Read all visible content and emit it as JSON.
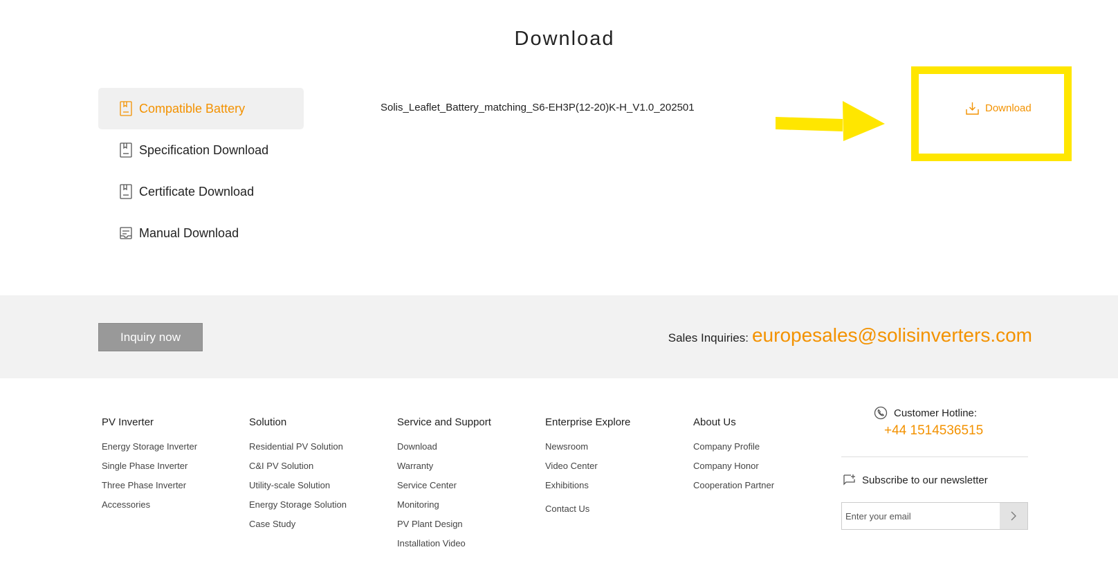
{
  "page": {
    "title": "Download"
  },
  "sidebar": {
    "items": [
      {
        "label": "Compatible Battery",
        "icon": "document-icon",
        "active": true
      },
      {
        "label": "Specification Download",
        "icon": "document-icon",
        "active": false
      },
      {
        "label": "Certificate Download",
        "icon": "document-icon",
        "active": false
      },
      {
        "label": "Manual Download",
        "icon": "manual-icon",
        "active": false
      }
    ]
  },
  "files": [
    {
      "name": "Solis_Leaflet_Battery_matching_S6-EH3P(12-20)K-H_V1.0_202501",
      "action_label": "Download"
    }
  ],
  "annotation": {
    "highlight_color": "#ffe600"
  },
  "inquiry": {
    "button_label": "Inquiry now",
    "sales_label": "Sales Inquiries:",
    "sales_email": "europesales@solisinverters.com"
  },
  "footer": {
    "columns": [
      {
        "heading": "PV Inverter",
        "links": [
          "Energy Storage Inverter",
          "Single Phase Inverter",
          "Three Phase Inverter",
          "Accessories"
        ]
      },
      {
        "heading": "Solution",
        "links": [
          "Residential PV Solution",
          "C&I PV Solution",
          "Utility-scale Solution",
          "Energy Storage Solution",
          "Case Study"
        ]
      },
      {
        "heading": "Service and Support",
        "links": [
          "Download",
          "Warranty",
          "Service Center",
          "Monitoring",
          "PV Plant Design",
          "Installation Video"
        ]
      },
      {
        "heading": "Enterprise Explore",
        "links": [
          "Newsroom",
          "Video Center",
          "Exhibitions"
        ],
        "extra_heading": "Contact Us"
      },
      {
        "heading": "About Us",
        "links": [
          "Company Profile",
          "Company Honor",
          "Cooperation Partner"
        ]
      }
    ],
    "hotline_label": "Customer Hotline:",
    "hotline_number": "+44 1514536515",
    "newsletter_label": "Subscribe to our newsletter",
    "email_placeholder": "Enter your email"
  },
  "colors": {
    "accent": "#f39200",
    "band": "#f2f2f2",
    "button": "#999999"
  }
}
